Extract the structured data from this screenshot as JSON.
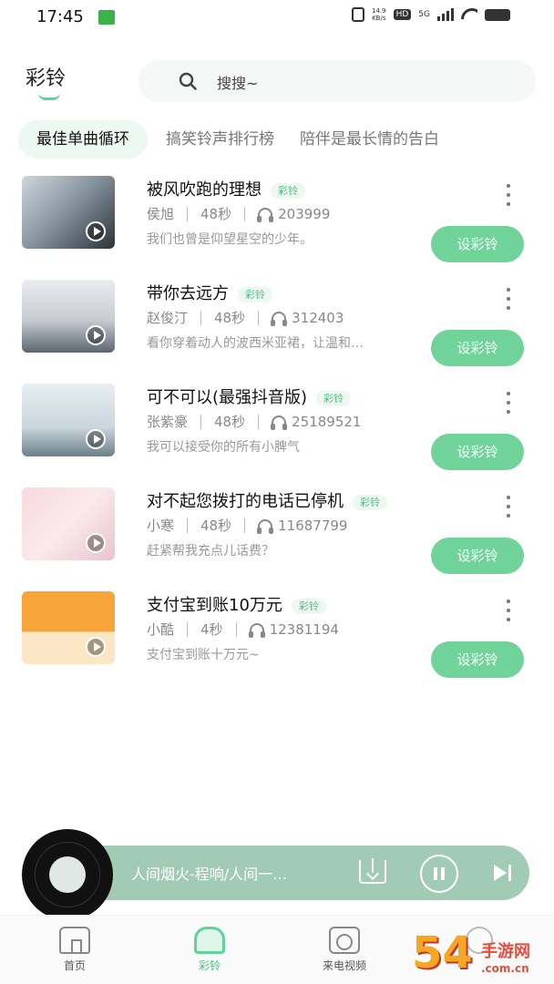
{
  "status_bar": {
    "time": "17:45",
    "net_speed_value": "14.9",
    "net_speed_unit": "KB/s",
    "hd": "HD",
    "network": "5G"
  },
  "header": {
    "title": "彩铃",
    "search_placeholder": "搜搜~"
  },
  "tabs": [
    {
      "label": "最佳单曲循环",
      "active": true
    },
    {
      "label": "搞笑铃声排行榜",
      "active": false
    },
    {
      "label": "陪伴是最长情的告白",
      "active": false
    }
  ],
  "songs": [
    {
      "title": "被风吹跑的理想",
      "tag": "彩铃",
      "artist": "侯旭",
      "duration": "48秒",
      "plays": "203999",
      "desc": "我们也曾是仰望星空的少年。",
      "button": "设彩铃"
    },
    {
      "title": "带你去远方",
      "tag": "彩铃",
      "artist": "赵俊汀",
      "duration": "48秒",
      "plays": "312403",
      "desc": "看你穿着动人的波西米亚裙，让温和…",
      "button": "设彩铃"
    },
    {
      "title": "可不可以(最强抖音版)",
      "tag": "彩铃",
      "artist": "张紫豪",
      "duration": "48秒",
      "plays": "25189521",
      "desc": "我可以接受你的所有小脾气",
      "button": "设彩铃"
    },
    {
      "title": "对不起您拨打的电话已停机",
      "tag": "彩铃",
      "artist": "小寒",
      "duration": "48秒",
      "plays": "11687799",
      "desc": "赶紧帮我充点儿话费？",
      "button": "设彩铃"
    },
    {
      "title": "支付宝到账10万元",
      "tag": "彩铃",
      "artist": "小酷",
      "duration": "4秒",
      "plays": "12381194",
      "desc": "支付宝到账十万元~",
      "button": "设彩铃"
    }
  ],
  "player": {
    "now_playing": "人间烟火-程响/人间一…"
  },
  "bottom_nav": [
    {
      "label": "首页",
      "active": false
    },
    {
      "label": "彩铃",
      "active": true
    },
    {
      "label": "来电视频",
      "active": false
    }
  ],
  "watermark": {
    "big": "54",
    "small": "手游网",
    "domain": ".com.cn"
  },
  "colors": {
    "accent": "#5ed49a",
    "button": "#6fd39a",
    "player": "#a2cbb6"
  }
}
